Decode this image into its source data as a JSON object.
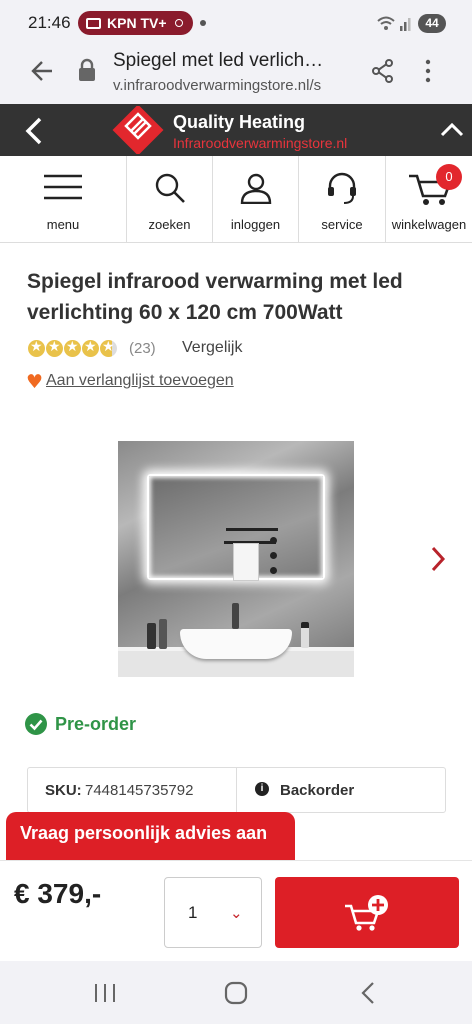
{
  "status_bar": {
    "time": "21:46",
    "notification": "KPN TV+",
    "battery": "44"
  },
  "browser": {
    "page_title": "Spiegel met led verlich…",
    "url": "v.infraroodverwarmingstore.nl/s"
  },
  "site_header": {
    "brand_name": "Quality Heating",
    "brand_domain": "Infraroodverwarmingstore.nl"
  },
  "nav": {
    "items": [
      {
        "label": "menu",
        "icon": "hamburger-icon"
      },
      {
        "label": "zoeken",
        "icon": "search-icon"
      },
      {
        "label": "inloggen",
        "icon": "user-icon"
      },
      {
        "label": "service",
        "icon": "headset-icon"
      },
      {
        "label": "winkelwagen",
        "icon": "cart-icon"
      }
    ],
    "cart_count": "0"
  },
  "product": {
    "title": "Spiegel infrarood verwarming met led verlichting 60 x 120 cm 700Watt",
    "rating": 4.7,
    "rating_max": 5,
    "review_count": "(23)",
    "compare_label": "Vergelijk",
    "wishlist_label": "Aan verlanglijst toevoegen",
    "availability": "Pre-order",
    "sku_label": "SKU:",
    "sku_value": "7448145735792",
    "stock_status": "Backorder"
  },
  "advice_button": "Vraag persoonlijk advies aan",
  "purchase": {
    "price": "€ 379,-",
    "quantity": "1"
  },
  "colors": {
    "brand_red": "#dd1f26",
    "header_dark": "#333333",
    "success_green": "#2f9447",
    "star_gold": "#e9c24a"
  }
}
